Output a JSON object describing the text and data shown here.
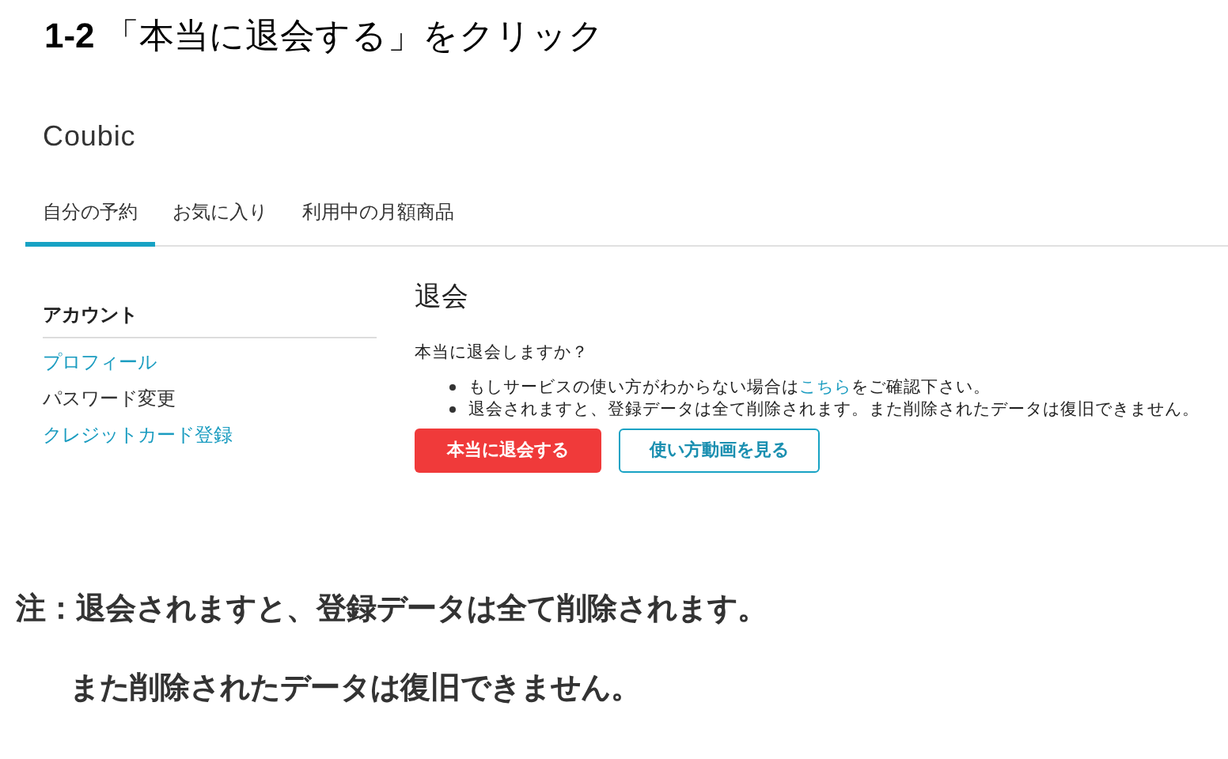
{
  "heading": "**1-2** 「本当に退会する」をクリック",
  "logo": "Coubic",
  "tabs": [
    {
      "label": "自分の予約",
      "selected": true
    },
    {
      "label": "お気に入り",
      "selected": false
    },
    {
      "label": "利用中の月額商品",
      "selected": false
    }
  ],
  "sidebar": {
    "title": "アカウント",
    "items": [
      {
        "label": "プロフィール",
        "kind": "link"
      },
      {
        "label": "パスワード変更",
        "kind": "text"
      },
      {
        "label": "クレジットカード登録",
        "kind": "link"
      }
    ]
  },
  "main": {
    "title": "退会",
    "question": "本当に退会しますか？",
    "bullets": [
      {
        "before": "もしサービスの使い方がわからない場合は",
        "link": "こちら",
        "after": "をご確認下さい。"
      },
      {
        "before": "退会されますと、登録データは全て削除されます。また削除されたデータは復旧できません。"
      }
    ],
    "buttons": [
      {
        "label": "本当に退会する",
        "kind": "danger"
      },
      {
        "label": "使い方動画を見る",
        "kind": "outline"
      }
    ]
  },
  "note": {
    "label": "注：",
    "lines": [
      "退会されますと、登録データは全て削除されます。",
      "また削除されたデータは復旧できません。"
    ]
  }
}
